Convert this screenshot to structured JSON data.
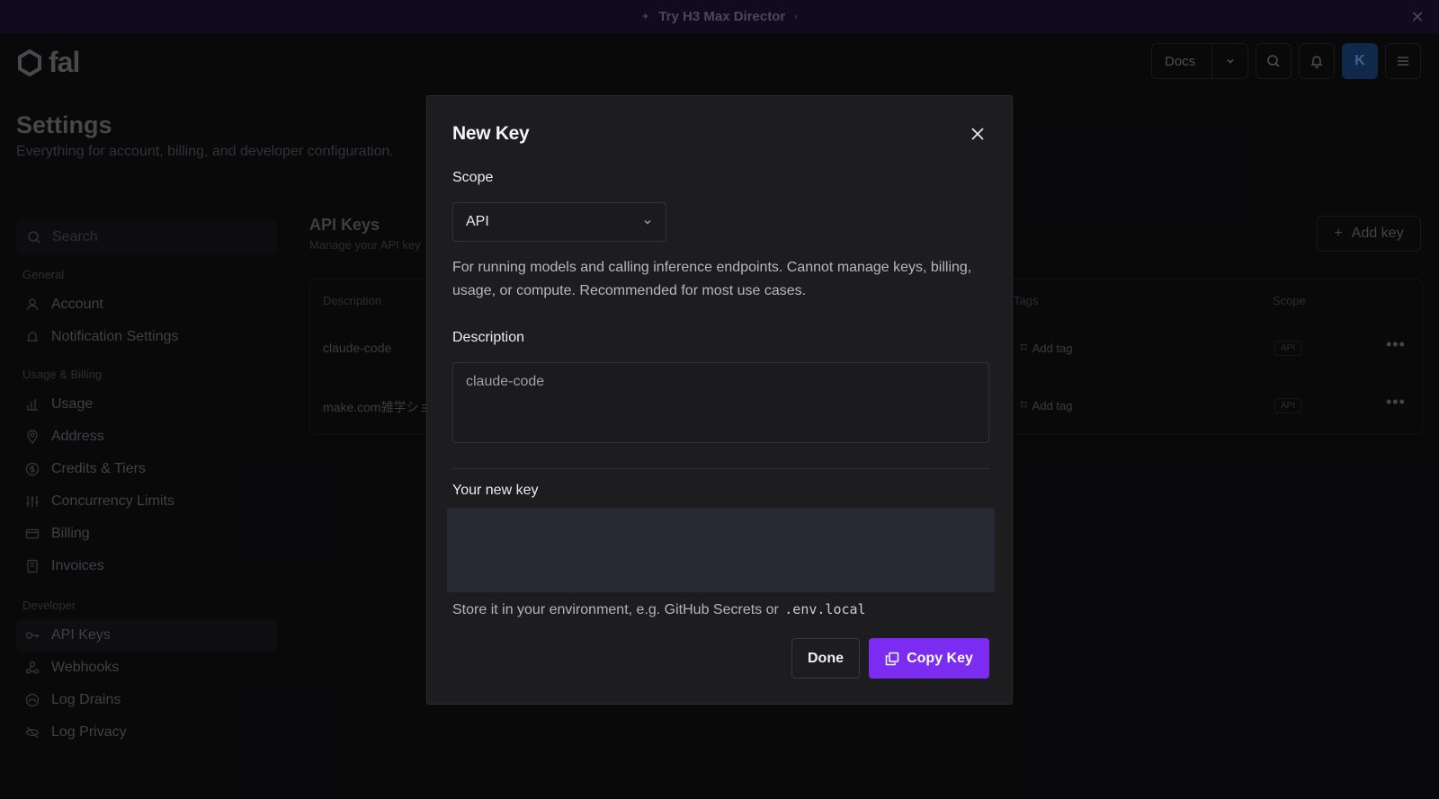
{
  "banner": {
    "text": "Try H3 Max Director"
  },
  "header": {
    "logo_text": "fal",
    "docs_label": "Docs",
    "avatar_initial": "K"
  },
  "page": {
    "title": "Settings",
    "subtitle": "Everything for account, billing, and developer configuration."
  },
  "sidebar": {
    "search_placeholder": "Search",
    "sections": [
      {
        "label": "General",
        "items": [
          {
            "label": "Account",
            "icon": "user-icon"
          },
          {
            "label": "Notification Settings",
            "icon": "bell-icon"
          }
        ]
      },
      {
        "label": "Usage & Billing",
        "items": [
          {
            "label": "Usage",
            "icon": "bar-chart-icon"
          },
          {
            "label": "Address",
            "icon": "map-pin-icon"
          },
          {
            "label": "Credits & Tiers",
            "icon": "dollar-icon"
          },
          {
            "label": "Concurrency Limits",
            "icon": "sliders-icon"
          },
          {
            "label": "Billing",
            "icon": "credit-card-icon"
          },
          {
            "label": "Invoices",
            "icon": "receipt-icon"
          }
        ]
      },
      {
        "label": "Developer",
        "items": [
          {
            "label": "API Keys",
            "icon": "key-icon",
            "active": true
          },
          {
            "label": "Webhooks",
            "icon": "webhook-icon"
          },
          {
            "label": "Log Drains",
            "icon": "log-drain-icon"
          },
          {
            "label": "Log Privacy",
            "icon": "eye-off-icon"
          }
        ]
      }
    ]
  },
  "content": {
    "title": "API Keys",
    "subtitle": "Manage your API key",
    "add_key_label": "Add key",
    "table": {
      "headers": {
        "description": "Description",
        "tags": "Tags",
        "scope": "Scope"
      },
      "rows": [
        {
          "description": "claude-code",
          "tag": "Add tag",
          "scope": "API"
        },
        {
          "description": "make.com雑学ショ",
          "tag": "Add tag",
          "scope": "API"
        }
      ]
    }
  },
  "modal": {
    "title": "New Key",
    "scope_label": "Scope",
    "scope_value": "API",
    "scope_description": "For running models and calling inference endpoints. Cannot manage keys, billing, usage, or compute. Recommended for most use cases.",
    "description_label": "Description",
    "description_value": "claude-code",
    "new_key_label": "Your new key",
    "store_note": "Store it in your environment, e.g. GitHub Secrets or",
    "store_note_code": ".env.local",
    "done_label": "Done",
    "copy_label": "Copy Key",
    "accent_color": "#7b2cf0"
  }
}
